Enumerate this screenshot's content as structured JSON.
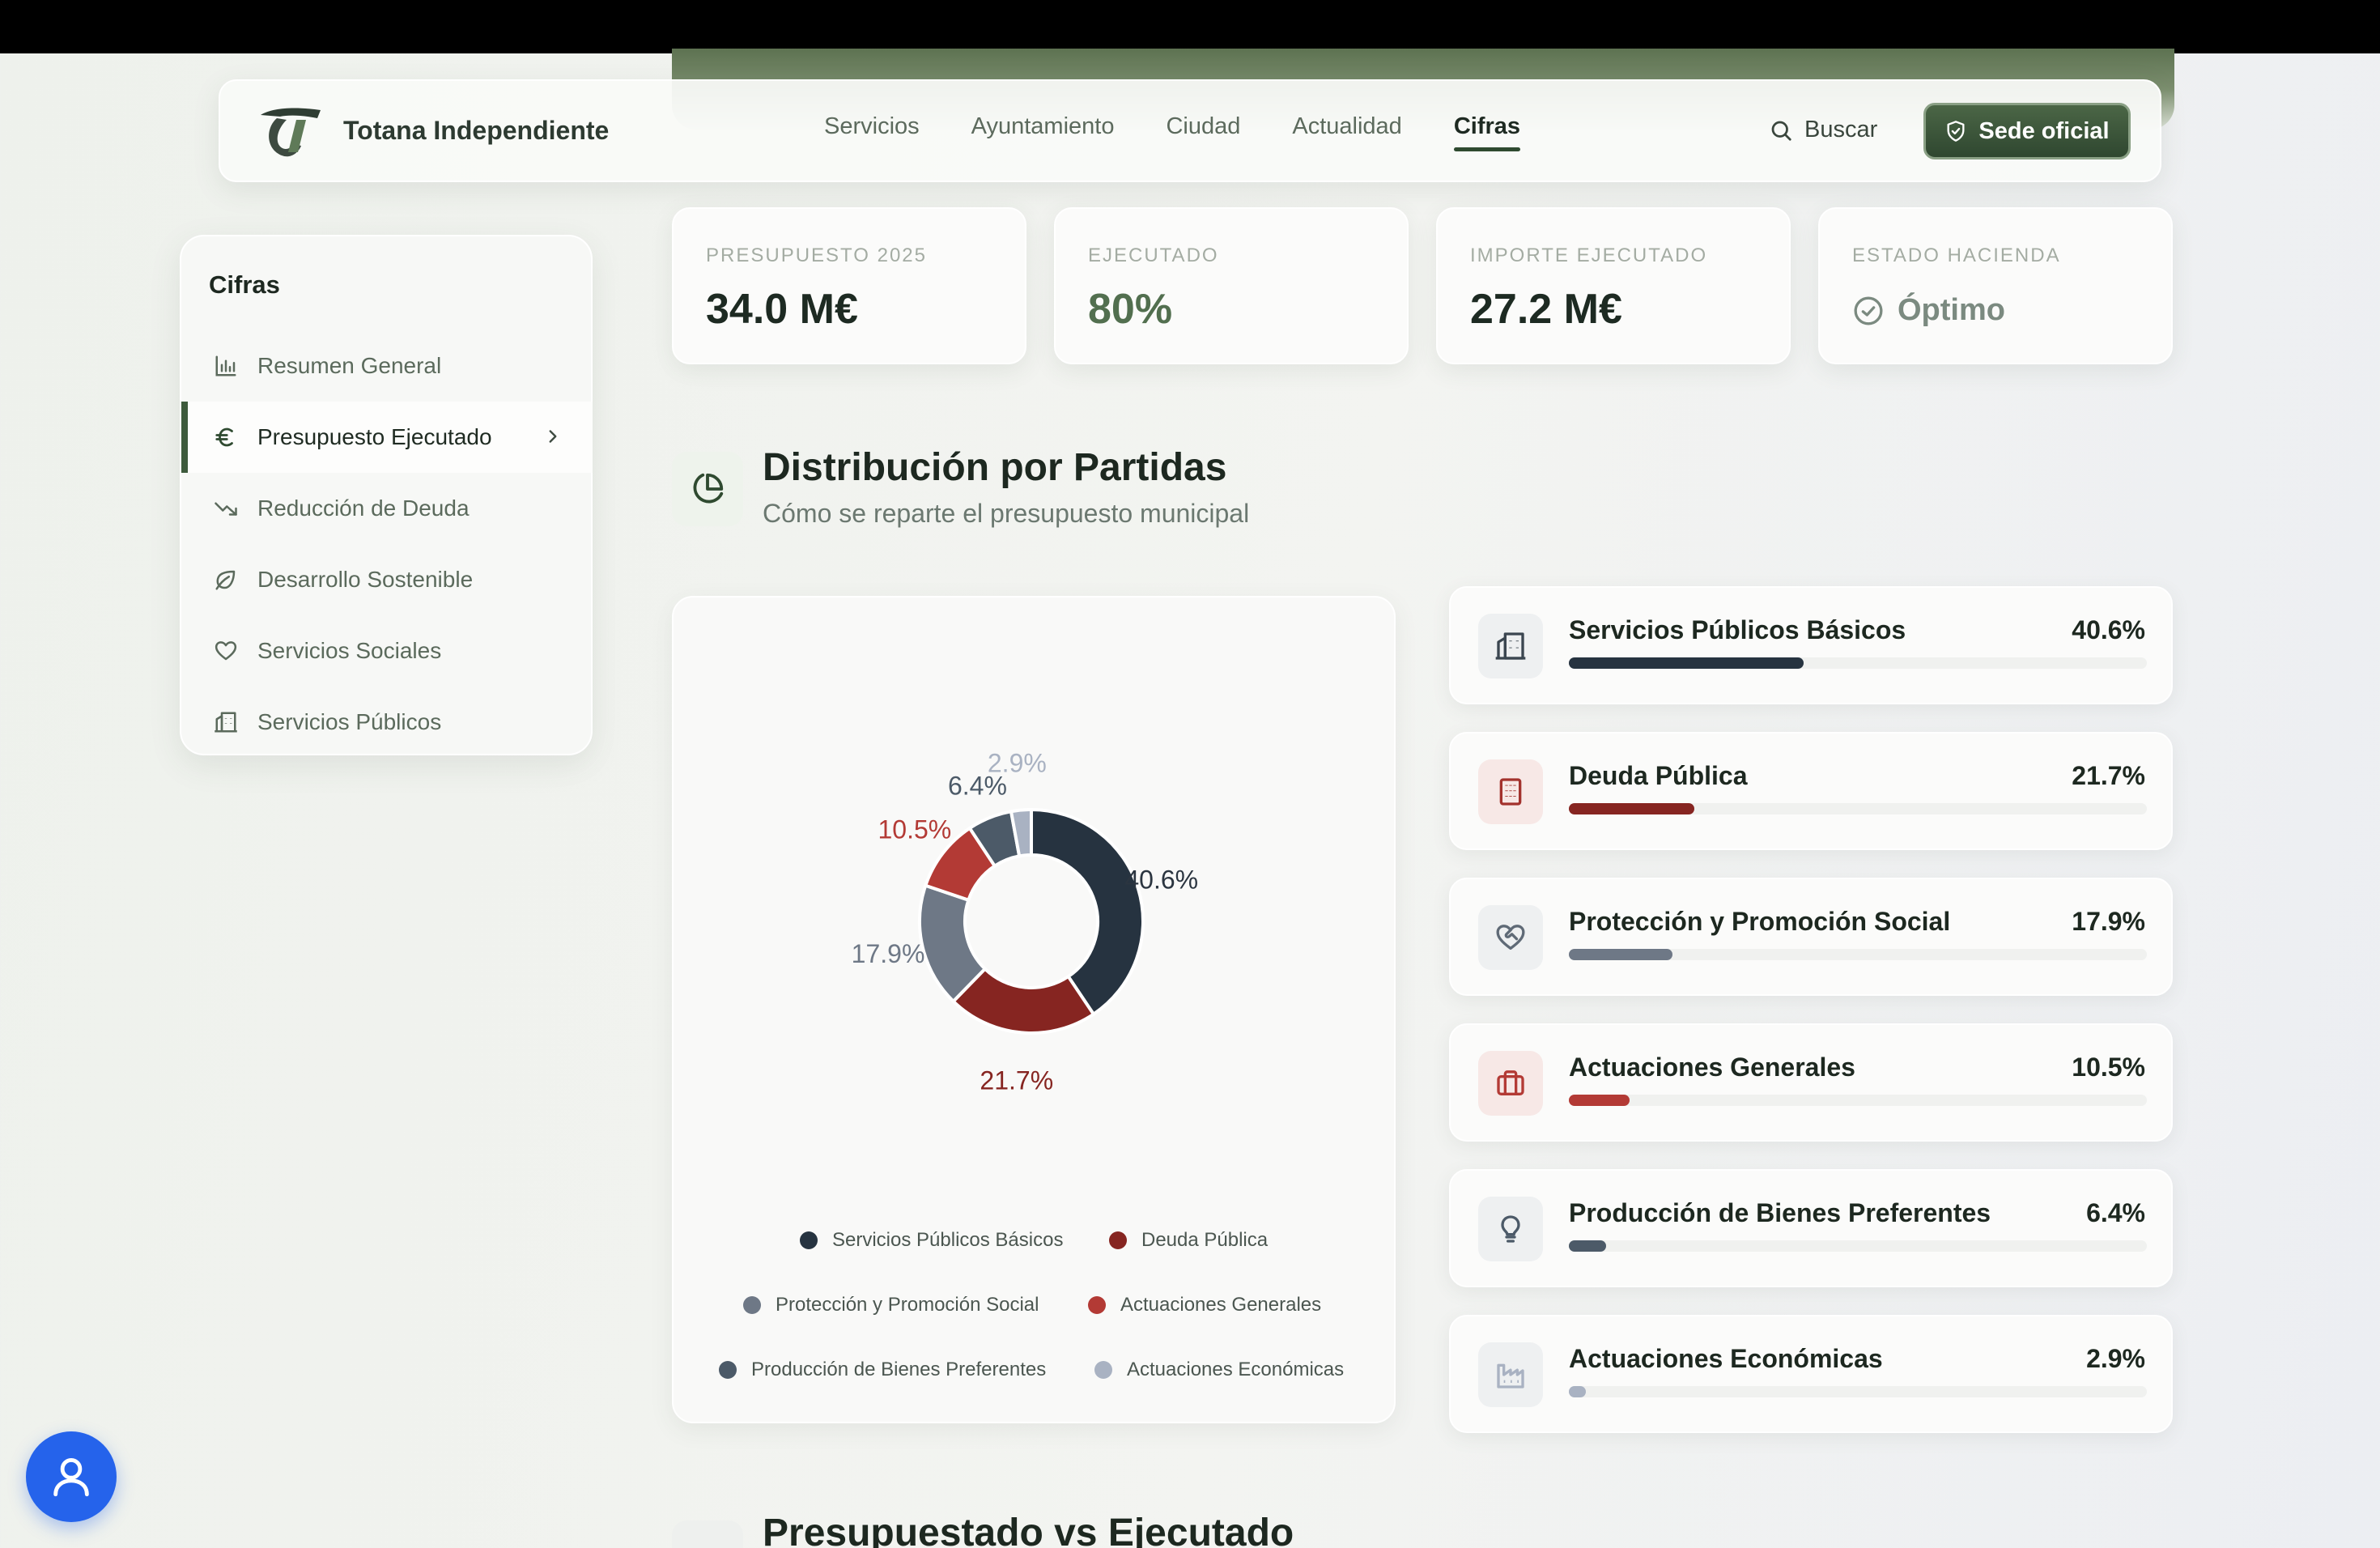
{
  "header": {
    "brand": "Totana Independiente",
    "nav": [
      {
        "label": "Servicios",
        "active": false
      },
      {
        "label": "Ayuntamiento",
        "active": false
      },
      {
        "label": "Ciudad",
        "active": false
      },
      {
        "label": "Actualidad",
        "active": false
      },
      {
        "label": "Cifras",
        "active": true
      }
    ],
    "search_label": "Buscar",
    "sede_label": "Sede oficial"
  },
  "sidebar": {
    "title": "Cifras",
    "items": [
      {
        "label": "Resumen General",
        "icon": "bar-chart-icon",
        "active": false
      },
      {
        "label": "Presupuesto Ejecutado",
        "icon": "euro-icon",
        "active": true
      },
      {
        "label": "Reducción de Deuda",
        "icon": "trending-down-icon",
        "active": false
      },
      {
        "label": "Desarrollo Sostenible",
        "icon": "leaf-icon",
        "active": false
      },
      {
        "label": "Servicios Sociales",
        "icon": "heart-icon",
        "active": false
      },
      {
        "label": "Servicios Públicos",
        "icon": "building-icon",
        "active": false
      }
    ]
  },
  "kpis": [
    {
      "label": "PRESUPUESTO 2025",
      "value": "34.0 M€"
    },
    {
      "label": "EJECUTADO",
      "value": "80%"
    },
    {
      "label": "IMPORTE EJECUTADO",
      "value": "27.2 M€"
    },
    {
      "label": "ESTADO HACIENDA",
      "value": "Óptimo"
    }
  ],
  "distribution": {
    "title": "Distribución por Partidas",
    "subtitle": "Cómo se reparte el presupuesto municipal"
  },
  "chart_data": {
    "type": "pie",
    "donut": true,
    "categories": [
      "Servicios Públicos Básicos",
      "Deuda Pública",
      "Protección y Promoción Social",
      "Actuaciones Generales",
      "Producción de Bienes Preferentes",
      "Actuaciones Económicas"
    ],
    "values": [
      40.6,
      21.7,
      17.9,
      10.5,
      6.4,
      2.9
    ],
    "labels": [
      "40.6%",
      "21.7%",
      "17.9%",
      "10.5%",
      "6.4%",
      "2.9%"
    ],
    "colors": [
      "#263340",
      "#862521",
      "#6e7886",
      "#b33a35",
      "#4c5a68",
      "#a9b2c2"
    ],
    "legend": "bottom"
  },
  "partidas": [
    {
      "name": "Servicios Públicos Básicos",
      "pct": "40.6%",
      "value": 40.6,
      "icon": "building-icon",
      "color": "#263340",
      "icon_bg": "#eef0f1",
      "icon_color": "#3b4650"
    },
    {
      "name": "Deuda Pública",
      "pct": "21.7%",
      "value": 21.7,
      "icon": "office-building-icon",
      "color": "#862521",
      "icon_bg": "#f7e8e6",
      "icon_color": "#a3322d"
    },
    {
      "name": "Protección y Promoción Social",
      "pct": "17.9%",
      "value": 17.9,
      "icon": "heart-handshake-icon",
      "color": "#6e7886",
      "icon_bg": "#eef0f1",
      "icon_color": "#5f6a76"
    },
    {
      "name": "Actuaciones Generales",
      "pct": "10.5%",
      "value": 10.5,
      "icon": "briefcase-icon",
      "color": "#b33a35",
      "icon_bg": "#f7e8e6",
      "icon_color": "#b33a35"
    },
    {
      "name": "Producción de Bienes Preferentes",
      "pct": "6.4%",
      "value": 6.4,
      "icon": "lightbulb-icon",
      "color": "#4c5a68",
      "icon_bg": "#eef0f1",
      "icon_color": "#4c5a68"
    },
    {
      "name": "Actuaciones Económicas",
      "pct": "2.9%",
      "value": 2.9,
      "icon": "factory-icon",
      "color": "#a9b2c2",
      "icon_bg": "#eef0f1",
      "icon_color": "#a9b2c2"
    }
  ],
  "next_section": {
    "title": "Presupuestado vs Ejecutado"
  }
}
